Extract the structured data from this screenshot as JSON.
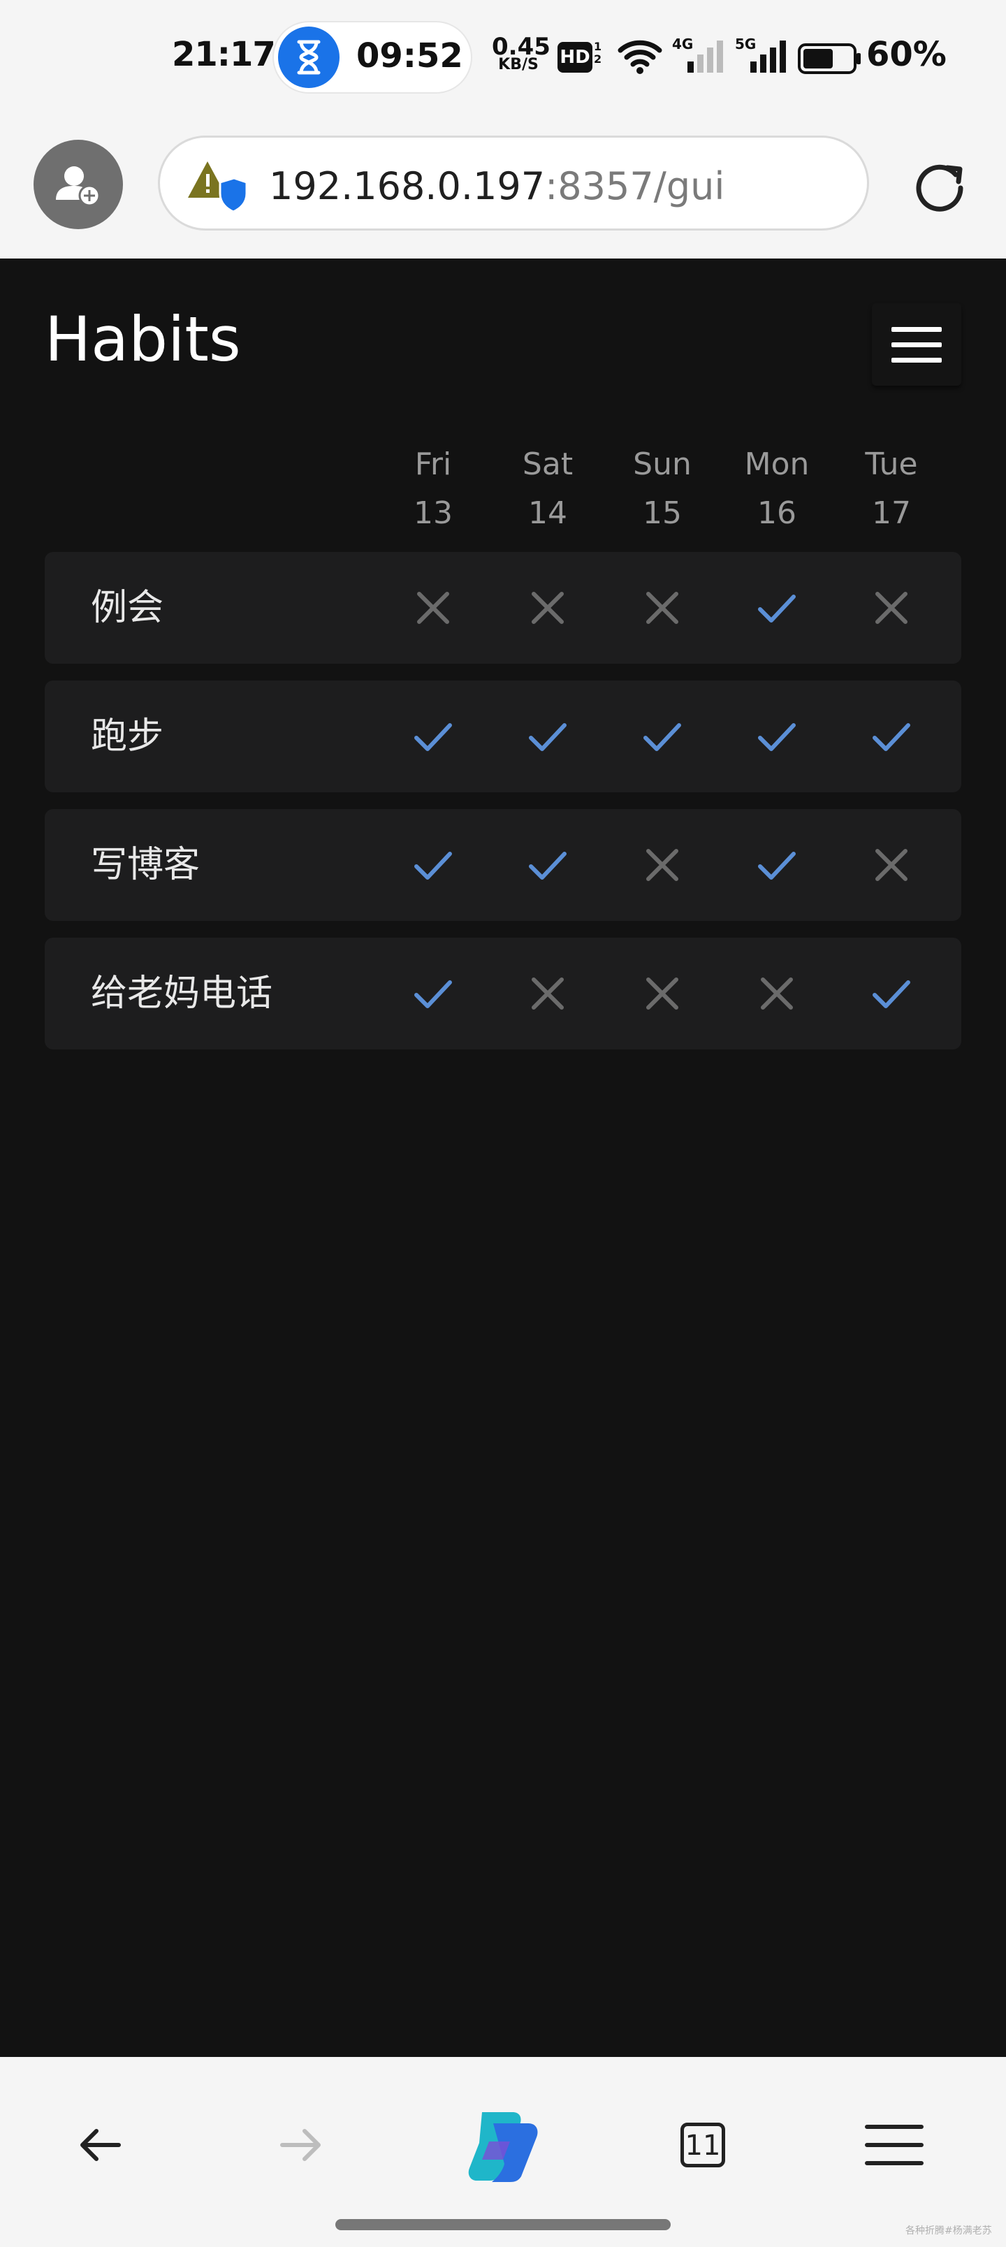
{
  "status_bar": {
    "time": "21:17",
    "timer_text": "09:52",
    "net_speed_value": "0.45",
    "net_speed_unit": "KB/S",
    "hd_label": "HD",
    "hd_sub_top": "1",
    "hd_sub_bottom": "2",
    "sig1_label": "4G",
    "sig2_label": "5G",
    "battery_percent": "60%",
    "battery_level": 0.6
  },
  "browser": {
    "url_host": "192.168.0.197",
    "url_rest": ":8357/gui"
  },
  "app": {
    "title": "Habits",
    "days": [
      {
        "name": "Fri",
        "date": "13"
      },
      {
        "name": "Sat",
        "date": "14"
      },
      {
        "name": "Sun",
        "date": "15"
      },
      {
        "name": "Mon",
        "date": "16"
      },
      {
        "name": "Tue",
        "date": "17"
      }
    ],
    "habits": [
      {
        "name": "例会",
        "checks": [
          false,
          false,
          false,
          true,
          false
        ]
      },
      {
        "name": "跑步",
        "checks": [
          true,
          true,
          true,
          true,
          true
        ]
      },
      {
        "name": "写博客",
        "checks": [
          true,
          true,
          false,
          true,
          false
        ]
      },
      {
        "name": "给老妈电话",
        "checks": [
          true,
          false,
          false,
          false,
          true
        ]
      }
    ],
    "colors": {
      "check": "#5b8fd6",
      "cross": "#6b6b6b",
      "row_bg": "#1d1d1e",
      "page_bg": "#121212"
    }
  },
  "bottom_nav": {
    "tabs_count": "11"
  },
  "watermark": "各种折腾#杨满老苏"
}
